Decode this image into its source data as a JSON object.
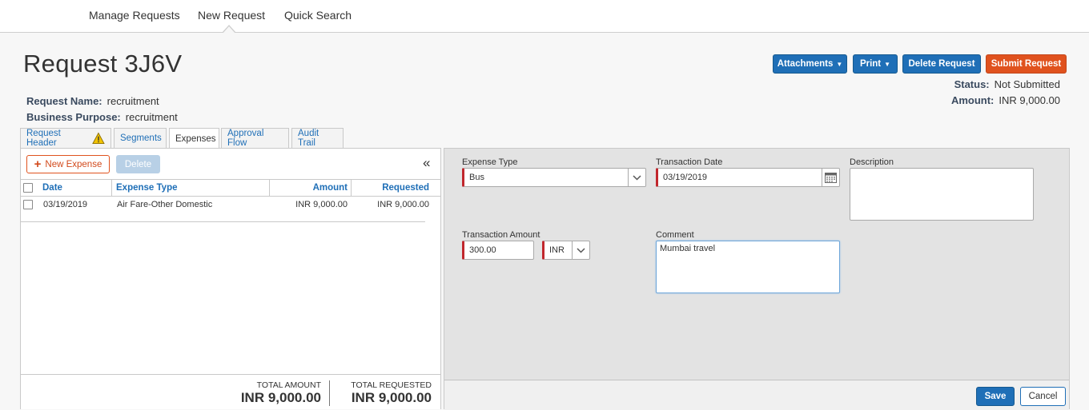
{
  "nav": {
    "items": [
      "Manage Requests",
      "New Request",
      "Quick Search"
    ],
    "active": "New Request"
  },
  "request": {
    "title": "Request 3J6V",
    "name_label": "Request Name:",
    "name_value": "recruitment",
    "purpose_label": "Business Purpose:",
    "purpose_value": "recruitment"
  },
  "actions": {
    "attachments": "Attachments",
    "print": "Print",
    "delete_request": "Delete Request",
    "submit_request": "Submit Request"
  },
  "status": {
    "status_label": "Status:",
    "status_value": "Not Submitted",
    "amount_label": "Amount:",
    "amount_value": "INR 9,000.00"
  },
  "tabs": [
    "Request Header",
    "Segments",
    "Expenses",
    "Approval Flow",
    "Audit Trail"
  ],
  "active_tab": "Expenses",
  "expenses_list": {
    "new_expense": "New Expense",
    "delete": "Delete",
    "collapse_glyph": "«",
    "columns": {
      "date": "Date",
      "type": "Expense Type",
      "amount": "Amount",
      "requested": "Requested"
    },
    "rows": [
      {
        "date": "03/19/2019",
        "type": "Air Fare-Other Domestic",
        "amount": "INR 9,000.00",
        "requested": "INR 9,000.00"
      }
    ],
    "total_amount_label": "TOTAL AMOUNT",
    "total_amount_value": "INR 9,000.00",
    "total_requested_label": "TOTAL REQUESTED",
    "total_requested_value": "INR 9,000.00"
  },
  "form": {
    "expense_type_label": "Expense Type",
    "expense_type_value": "Bus",
    "transaction_date_label": "Transaction Date",
    "transaction_date_value": "03/19/2019",
    "description_label": "Description",
    "description_value": "",
    "transaction_amount_label": "Transaction Amount",
    "transaction_amount_value": "300.00",
    "currency_value": "INR",
    "comment_label": "Comment",
    "comment_value": "Mumbai travel",
    "save": "Save",
    "cancel": "Cancel"
  },
  "colors": {
    "primary": "#1f6fb7",
    "submit": "#e0521e",
    "required": "#c1272d",
    "warning": "#f2c300"
  }
}
